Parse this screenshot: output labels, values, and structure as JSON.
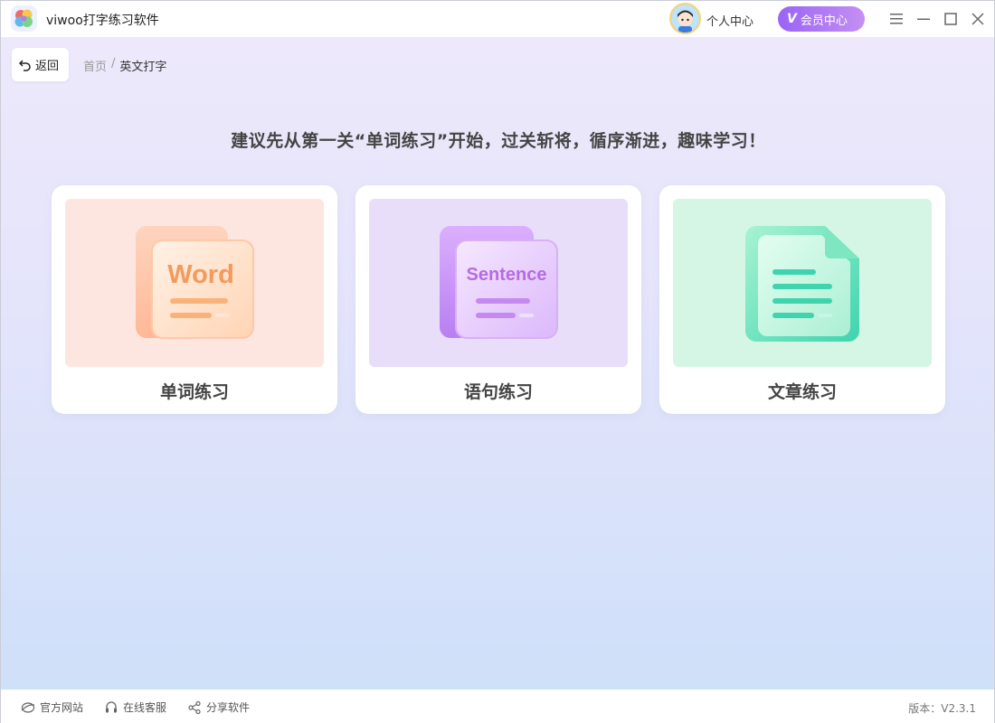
{
  "app": {
    "title": "viwoo打字练习软件"
  },
  "header": {
    "personal_center": "个人中心",
    "vip_icon": "V",
    "vip_label": "会员中心",
    "controls": [
      "menu-icon",
      "minimize-icon",
      "maximize-icon",
      "close-icon"
    ]
  },
  "nav": {
    "back_label": "返回",
    "breadcrumb": {
      "home": "首页",
      "separator": "/",
      "current": "英文打字"
    }
  },
  "main": {
    "hint": "建议先从第一关“单词练习”开始，过关斩将，循序渐进，趣味学习！",
    "cards": [
      {
        "label": "单词练习",
        "art_text": "Word",
        "bg": "#fde5e0",
        "accent": "#f5a06b"
      },
      {
        "label": "语句练习",
        "art_text": "Sentence",
        "bg": "#e8defa",
        "accent": "#b76be8"
      },
      {
        "label": "文章练习",
        "art_text": "",
        "bg": "#d5f6e4",
        "accent": "#3fd4ae"
      }
    ]
  },
  "footer": {
    "website": "官方网站",
    "support": "在线客服",
    "share": "分享软件",
    "version": "版本：V2.3.1"
  },
  "colors": {
    "vip_gradient_start": "#9a64f5",
    "vip_gradient_end": "#c58ff3"
  }
}
